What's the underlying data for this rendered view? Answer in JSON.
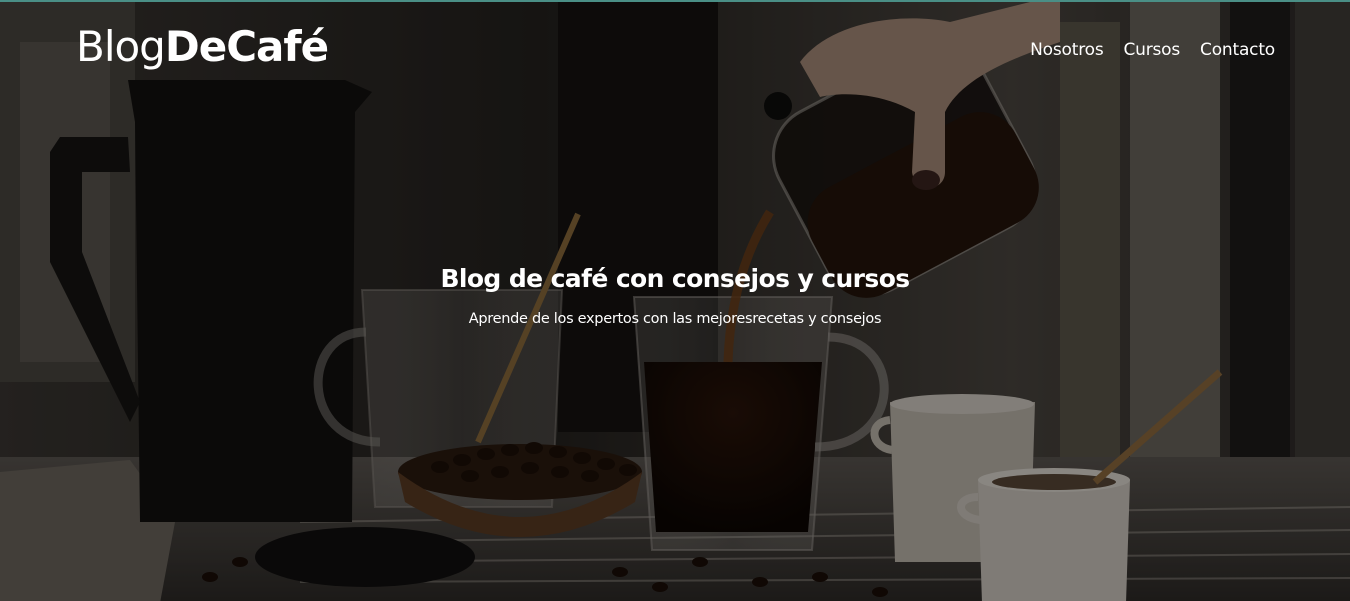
{
  "header": {
    "logo": {
      "light": "Blog",
      "bold": "DeCafé"
    },
    "nav": [
      {
        "label": "Nosotros"
      },
      {
        "label": "Cursos"
      },
      {
        "label": "Contacto"
      }
    ]
  },
  "hero": {
    "title": "Blog de café con consejos y cursos",
    "subtitle": "Aprende de los expertos con las mejoresrecetas y consejos",
    "overlay_color": "#000000"
  },
  "colors": {
    "text": "#ffffff",
    "accent_top_border": "#4a8f86"
  }
}
